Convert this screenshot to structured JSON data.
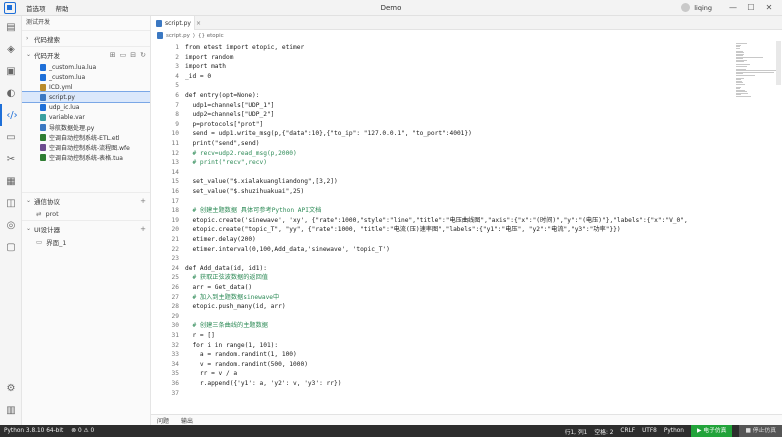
{
  "titlebar": {
    "menu": [
      "首选项",
      "帮助"
    ],
    "title": "Demo",
    "username": "liqing",
    "controls": [
      "—",
      "☐",
      "✕"
    ]
  },
  "sidebar": {
    "header": "测试开发",
    "sections": {
      "search": "代码搜索",
      "dev": "代码开发",
      "protocol": "通信协议",
      "ui": "UI设计器"
    },
    "files": [
      {
        "name": "_custom.lua.lua",
        "color": "#1e6fd8"
      },
      {
        "name": "_custom.lua",
        "color": "#1e6fd8"
      },
      {
        "name": "ICD.yml",
        "color": "#b98b2b"
      },
      {
        "name": "script.py",
        "color": "#3b78c2"
      },
      {
        "name": "udp_ic.lua",
        "color": "#1e6fd8"
      },
      {
        "name": "variable.var",
        "color": "#3aa0a0"
      },
      {
        "name": "导航数据处理.py",
        "color": "#3b78c2"
      },
      {
        "name": "空调自动控制系统-ETL.etl",
        "color": "#2e7d32"
      },
      {
        "name": "空调自动控制系统-流程图.wfe",
        "color": "#6d4c8f"
      },
      {
        "name": "空调自动控制系统-表格.tua",
        "color": "#2e7d32"
      }
    ],
    "protocol_item": "prot",
    "ui_item": "界面_1"
  },
  "editor": {
    "tab": "script.py",
    "breadcrumb": [
      "script.py",
      "⟩",
      "{} etopic"
    ],
    "lines": [
      {
        "n": "1",
        "t": "from etest import etopic, etimer"
      },
      {
        "n": "2",
        "t": "import random"
      },
      {
        "n": "3",
        "t": "import math"
      },
      {
        "n": "4",
        "t": "_id = 0"
      },
      {
        "n": "5",
        "t": ""
      },
      {
        "n": "6",
        "t": "def entry(opt=None):"
      },
      {
        "n": "7",
        "t": "  udp1=channels[\"UDP_1\"]"
      },
      {
        "n": "8",
        "t": "  udp2=channels[\"UDP_2\"]"
      },
      {
        "n": "9",
        "t": "  p=protocols[\"prot\"]"
      },
      {
        "n": "10",
        "t": "  send = udp1.write_msg(p,{\"data\":10},{\"to_ip\": \"127.0.0.1\", \"to_port\":4001})"
      },
      {
        "n": "11",
        "t": "  print(\"send\",send)"
      },
      {
        "n": "12",
        "t": "  # recv=udp2.read_msg(p,2000)"
      },
      {
        "n": "13",
        "t": "  # print(\"recv\",recv)"
      },
      {
        "n": "14",
        "t": ""
      },
      {
        "n": "15",
        "t": "  set_value(\"$.xialakuangliandong\",[3,2])"
      },
      {
        "n": "16",
        "t": "  set_value(\"$.shuzihuakuai\",25)"
      },
      {
        "n": "17",
        "t": ""
      },
      {
        "n": "18",
        "t": "  # 创建主题数据 具体可参考Python API文档"
      },
      {
        "n": "19",
        "t": "  etopic.create('sinewave', 'xy', {\"rate\":1000,\"style\":\"line\",\"title\":\"电压曲线图\",\"axis\":{\"x\":\"(时间)\",\"y\":\"(电压)\"},\"labels\":{\"x\":\"V_0\","
      },
      {
        "n": "20",
        "t": "  etopic.create(\"topic_T\", \"yy\", {\"rate\":1000, \"title\":\"电流(压)速率图\",\"labels\":{\"y1\":\"电压\", \"y2\":\"电流\",\"y3\":\"功率\"}})"
      },
      {
        "n": "21",
        "t": "  etimer.delay(200)"
      },
      {
        "n": "22",
        "t": "  etimer.interval(0,100,Add_data,'sinewave', 'topic_T')"
      },
      {
        "n": "23",
        "t": ""
      },
      {
        "n": "24",
        "t": "def Add_data(id, id1):"
      },
      {
        "n": "25",
        "t": "  # 获取正弦波数据的返回值"
      },
      {
        "n": "26",
        "t": "  arr = Get_data()"
      },
      {
        "n": "27",
        "t": "  # 加入到主题数据sinewave中"
      },
      {
        "n": "28",
        "t": "  etopic.push_many(id, arr)"
      },
      {
        "n": "29",
        "t": ""
      },
      {
        "n": "30",
        "t": "  # 创建三条曲线的主题数据"
      },
      {
        "n": "31",
        "t": "  r = []"
      },
      {
        "n": "32",
        "t": "  for i in range(1, 101):"
      },
      {
        "n": "33",
        "t": "    a = random.randint(1, 100)"
      },
      {
        "n": "34",
        "t": "    v = random.randint(500, 1000)"
      },
      {
        "n": "35",
        "t": "    rr = v / a"
      },
      {
        "n": "36",
        "t": "    r.append({'y1': a, 'y2': v, 'y3': rr})"
      },
      {
        "n": "37",
        "t": ""
      }
    ]
  },
  "panel": {
    "tabs": [
      "问题",
      "输出"
    ]
  },
  "statusbar": {
    "python": "Python 3.8.10 64-bit",
    "problems": "⊗ 0 ⚠ 0",
    "position": "行1, 列1",
    "spaces": "空格: 2",
    "eol": "CRLF",
    "encoding": "UTF8",
    "lang": "Python",
    "run": "▶ 电子仿真",
    "stop": "■ 停止仿真"
  }
}
